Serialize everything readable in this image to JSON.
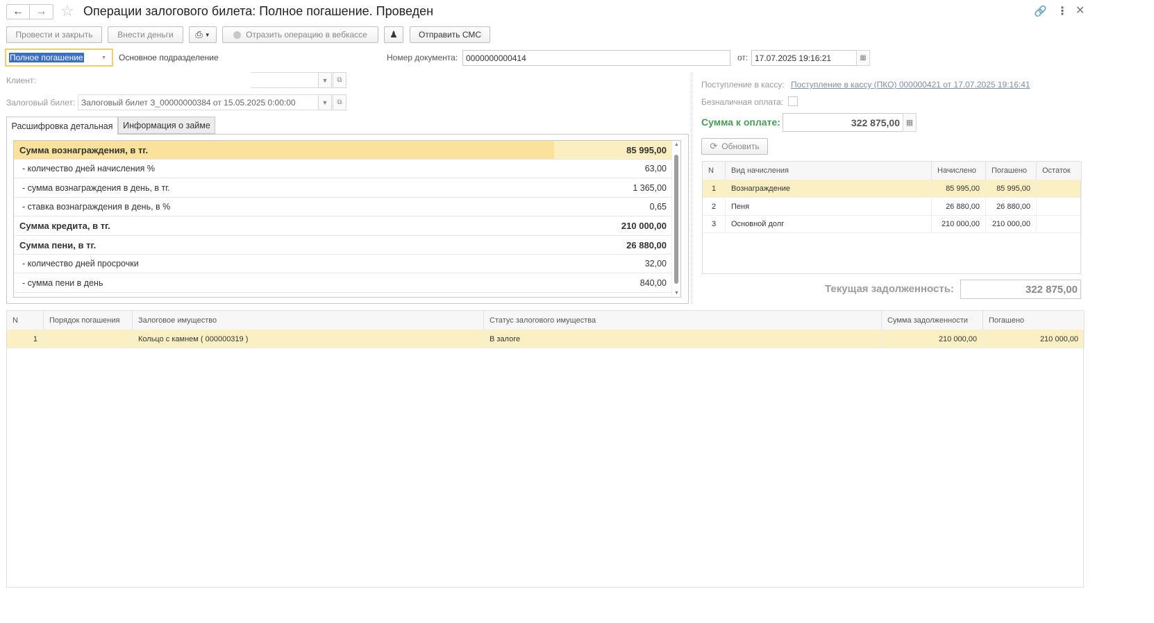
{
  "title": "Операции залогового билета: Полное погашение. Проведен",
  "toolbar": {
    "post_close": "Провести и закрыть",
    "deposit": "Внести деньги",
    "web_cash": "Отразить операцию в вебкассе",
    "send_sms": "Отправить СМС"
  },
  "header": {
    "operation_type": "Полное погашение",
    "division": "Основное подразделение",
    "doc_number_label": "Номер документа:",
    "doc_number": "0000000000414",
    "date_label": "от:",
    "date": "17.07.2025 19:16:21",
    "client_label": "Клиент:",
    "client_value": "",
    "ticket_label": "Залоговый билет:",
    "ticket_value": "Залоговый билет З_00000000384 от 15.05.2025 0:00:00"
  },
  "tabs": [
    "Расшифровка детальная",
    "Информация о займе"
  ],
  "detail": [
    {
      "label": "Сумма вознаграждения, в тг.",
      "value": "85 995,00",
      "bold": true
    },
    {
      "label": " - количество дней начисления %",
      "value": "63,00",
      "bold": false
    },
    {
      "label": " - сумма вознаграждения в день, в тг.",
      "value": "1 365,00",
      "bold": false
    },
    {
      "label": " - ставка вознаграждения в день, в %",
      "value": "0,65",
      "bold": false
    },
    {
      "label": "Сумма кредита, в тг.",
      "value": "210 000,00",
      "bold": true
    },
    {
      "label": "Сумма пени, в тг.",
      "value": "26 880,00",
      "bold": true
    },
    {
      "label": " - количество дней просрочки",
      "value": "32,00",
      "bold": false
    },
    {
      "label": " - сумма пени в день",
      "value": "840,00",
      "bold": false
    }
  ],
  "right": {
    "receipt_label": "Поступление в кассу:",
    "receipt_link": "Поступление в кассу (ПКО) 000000421 от 17.07.2025 19:16:41",
    "cashless_label": "Безналичная оплата:",
    "sum_label": "Сумма к оплате:",
    "sum_value": "322 875,00",
    "refresh": "Обновить",
    "debt_label": "Текущая задолженность:",
    "debt_value": "322 875,00"
  },
  "accruals": {
    "headers": [
      "N",
      "Вид начисления",
      "Начислено",
      "Погашено",
      "Остаток"
    ],
    "rows": [
      [
        "1",
        "Вознаграждение",
        "85 995,00",
        "85 995,00",
        ""
      ],
      [
        "2",
        "Пеня",
        "26 880,00",
        "26 880,00",
        ""
      ],
      [
        "3",
        "Основной долг",
        "210 000,00",
        "210 000,00",
        ""
      ]
    ]
  },
  "items": {
    "headers": [
      "N",
      "Порядок погашения",
      "Залоговое имущество",
      "Статус залогового имущества",
      "Сумма задолженности",
      "Погашено"
    ],
    "rows": [
      [
        "1",
        "",
        "Кольцо с камнем ( 000000319 )",
        "В залоге",
        "210 000,00",
        "210 000,00"
      ]
    ]
  },
  "colors": {
    "highlight": "#fae29c",
    "row_selected": "#fbf0c4",
    "green_label": "#4c9a5a",
    "link": "#5a7aa0"
  }
}
